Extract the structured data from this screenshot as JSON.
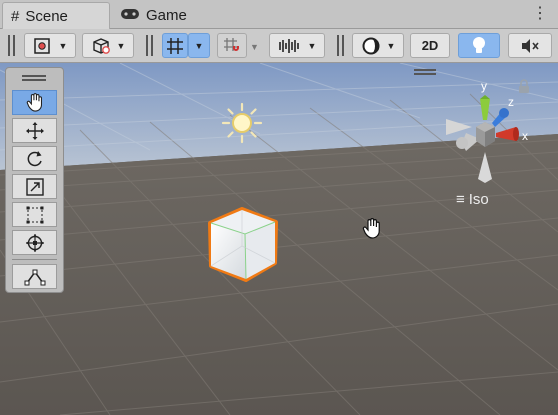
{
  "tabs": [
    {
      "label": "Scene",
      "icon": "grid-hash-icon",
      "active": true
    },
    {
      "label": "Game",
      "icon": "gamepad-icon",
      "active": false
    }
  ],
  "toolbar": {
    "mode_2d_label": "2D"
  },
  "gizmo": {
    "y_label": "y",
    "z_label": "z",
    "x_label": "x",
    "projection_label": "Iso"
  },
  "tools": [
    {
      "name": "hand-tool",
      "active": true
    },
    {
      "name": "move-tool",
      "active": false
    },
    {
      "name": "rotate-tool",
      "active": false
    },
    {
      "name": "scale-tool",
      "active": false
    },
    {
      "name": "rect-tool",
      "active": false
    },
    {
      "name": "transform-tool",
      "active": false
    },
    {
      "name": "custom-editor-tool",
      "active": false
    }
  ],
  "colors": {
    "selection_outline": "#f07a14",
    "axis_y": "#8ccc3c",
    "axis_z": "#3a7ddc",
    "axis_x": "#d23a2a",
    "active_blue": "#79a9e6",
    "ground": "#5f5a55",
    "sky": "#8fa6c9"
  }
}
